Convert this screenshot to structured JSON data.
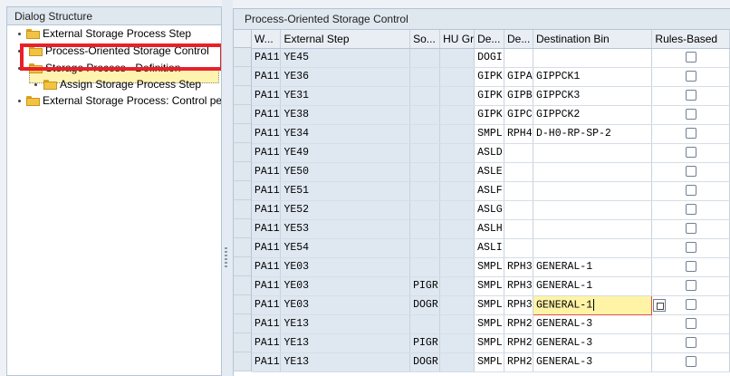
{
  "left": {
    "title": "Dialog Structure",
    "tree": [
      {
        "label": "External Storage Process Step"
      },
      {
        "label": "Process-Oriented Storage Control"
      },
      {
        "label": "Storage Process - Definition"
      },
      {
        "label": "Assign Storage Process Step"
      },
      {
        "label": "External Storage Process: Control per"
      }
    ]
  },
  "right": {
    "title": "Process-Oriented Storage Control",
    "columns": [
      "W...",
      "External Step",
      "So...",
      "HU Gr",
      "De...",
      "De...",
      "Destination Bin",
      "Rules-Based"
    ],
    "rows": [
      {
        "w": "PA11",
        "step": "YE45",
        "so": "",
        "hu": "",
        "de1": "DOGI",
        "de2": "",
        "bin": "",
        "rules": false
      },
      {
        "w": "PA11",
        "step": "YE36",
        "so": "",
        "hu": "",
        "de1": "GIPK",
        "de2": "GIPA",
        "bin": "GIPPCK1",
        "rules": false
      },
      {
        "w": "PA11",
        "step": "YE31",
        "so": "",
        "hu": "",
        "de1": "GIPK",
        "de2": "GIPB",
        "bin": "GIPPCK3",
        "rules": false
      },
      {
        "w": "PA11",
        "step": "YE38",
        "so": "",
        "hu": "",
        "de1": "GIPK",
        "de2": "GIPC",
        "bin": "GIPPCK2",
        "rules": false
      },
      {
        "w": "PA11",
        "step": "YE34",
        "so": "",
        "hu": "",
        "de1": "SMPL",
        "de2": "RPH4",
        "bin": "D-H0-RP-SP-2",
        "rules": false
      },
      {
        "w": "PA11",
        "step": "YE49",
        "so": "",
        "hu": "",
        "de1": "ASLD",
        "de2": "",
        "bin": "",
        "rules": false
      },
      {
        "w": "PA11",
        "step": "YE50",
        "so": "",
        "hu": "",
        "de1": "ASLE",
        "de2": "",
        "bin": "",
        "rules": false
      },
      {
        "w": "PA11",
        "step": "YE51",
        "so": "",
        "hu": "",
        "de1": "ASLF",
        "de2": "",
        "bin": "",
        "rules": false
      },
      {
        "w": "PA11",
        "step": "YE52",
        "so": "",
        "hu": "",
        "de1": "ASLG",
        "de2": "",
        "bin": "",
        "rules": false
      },
      {
        "w": "PA11",
        "step": "YE53",
        "so": "",
        "hu": "",
        "de1": "ASLH",
        "de2": "",
        "bin": "",
        "rules": false
      },
      {
        "w": "PA11",
        "step": "YE54",
        "so": "",
        "hu": "",
        "de1": "ASLI",
        "de2": "",
        "bin": "",
        "rules": false
      },
      {
        "w": "PA11",
        "step": "YE03",
        "so": "",
        "hu": "",
        "de1": "SMPL",
        "de2": "RPH3",
        "bin": "GENERAL-1",
        "rules": false
      },
      {
        "w": "PA11",
        "step": "YE03",
        "so": "PIGR",
        "hu": "",
        "de1": "SMPL",
        "de2": "RPH3",
        "bin": "GENERAL-1",
        "rules": false
      },
      {
        "w": "PA11",
        "step": "YE03",
        "so": "DOGR",
        "hu": "",
        "de1": "SMPL",
        "de2": "RPH3",
        "bin": "GENERAL-1",
        "rules": false,
        "active": true
      },
      {
        "w": "PA11",
        "step": "YE13",
        "so": "",
        "hu": "",
        "de1": "SMPL",
        "de2": "RPH2",
        "bin": "GENERAL-3",
        "rules": false
      },
      {
        "w": "PA11",
        "step": "YE13",
        "so": "PIGR",
        "hu": "",
        "de1": "SMPL",
        "de2": "RPH2",
        "bin": "GENERAL-3",
        "rules": false
      },
      {
        "w": "PA11",
        "step": "YE13",
        "so": "DOGR",
        "hu": "",
        "de1": "SMPL",
        "de2": "RPH2",
        "bin": "GENERAL-3",
        "rules": false
      }
    ]
  }
}
